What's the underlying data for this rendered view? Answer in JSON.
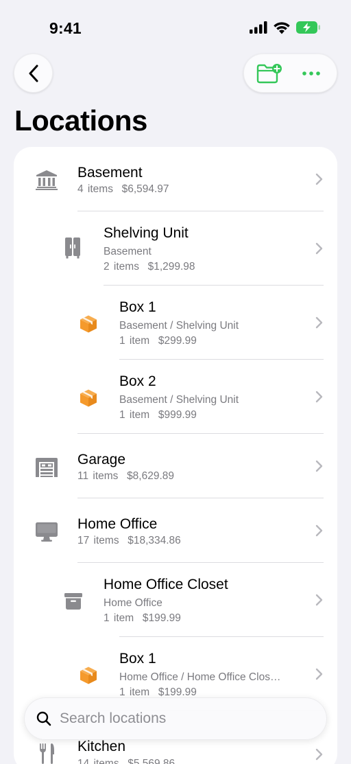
{
  "status_bar": {
    "time": "9:41"
  },
  "header": {
    "back_icon": "chevron-left-icon",
    "add_folder_icon": "folder-plus-icon",
    "more_icon": "ellipsis-icon",
    "accent_color": "#34c759"
  },
  "page_title": "Locations",
  "locations": [
    {
      "icon": "building-columns-icon",
      "name": "Basement",
      "path": "",
      "count": "4 items",
      "value": "$6,594.97"
    },
    {
      "icon": "cabinet-icon",
      "name": "Shelving Unit",
      "path": "Basement",
      "count": "2 items",
      "value": "$1,299.98"
    },
    {
      "icon": "box-icon",
      "name": "Box 1",
      "path": "Basement / Shelving Unit",
      "count": "1 item",
      "value": "$299.99"
    },
    {
      "icon": "box-icon",
      "name": "Box 2",
      "path": "Basement / Shelving Unit",
      "count": "1 item",
      "value": "$999.99"
    },
    {
      "icon": "garage-icon",
      "name": "Garage",
      "path": "",
      "count": "11 items",
      "value": "$8,629.89"
    },
    {
      "icon": "desktop-computer-icon",
      "name": "Home Office",
      "path": "",
      "count": "17 items",
      "value": "$18,334.86"
    },
    {
      "icon": "archive-box-icon",
      "name": "Home Office Closet",
      "path": "Home Office",
      "count": "1 item",
      "value": "$199.99"
    },
    {
      "icon": "box-icon",
      "name": "Box 1",
      "path": "Home Office / Home Office Clos…",
      "count": "1 item",
      "value": "$199.99"
    },
    {
      "icon": "fork-knife-icon",
      "name": "Kitchen",
      "path": "",
      "count": "14 items",
      "value": "$5,569.86"
    }
  ],
  "colors": {
    "box": "#f59a2c",
    "icon_gray": "#8a8a8e",
    "secondary_text": "#7a7a7f"
  },
  "search": {
    "placeholder": "Search locations",
    "value": ""
  }
}
